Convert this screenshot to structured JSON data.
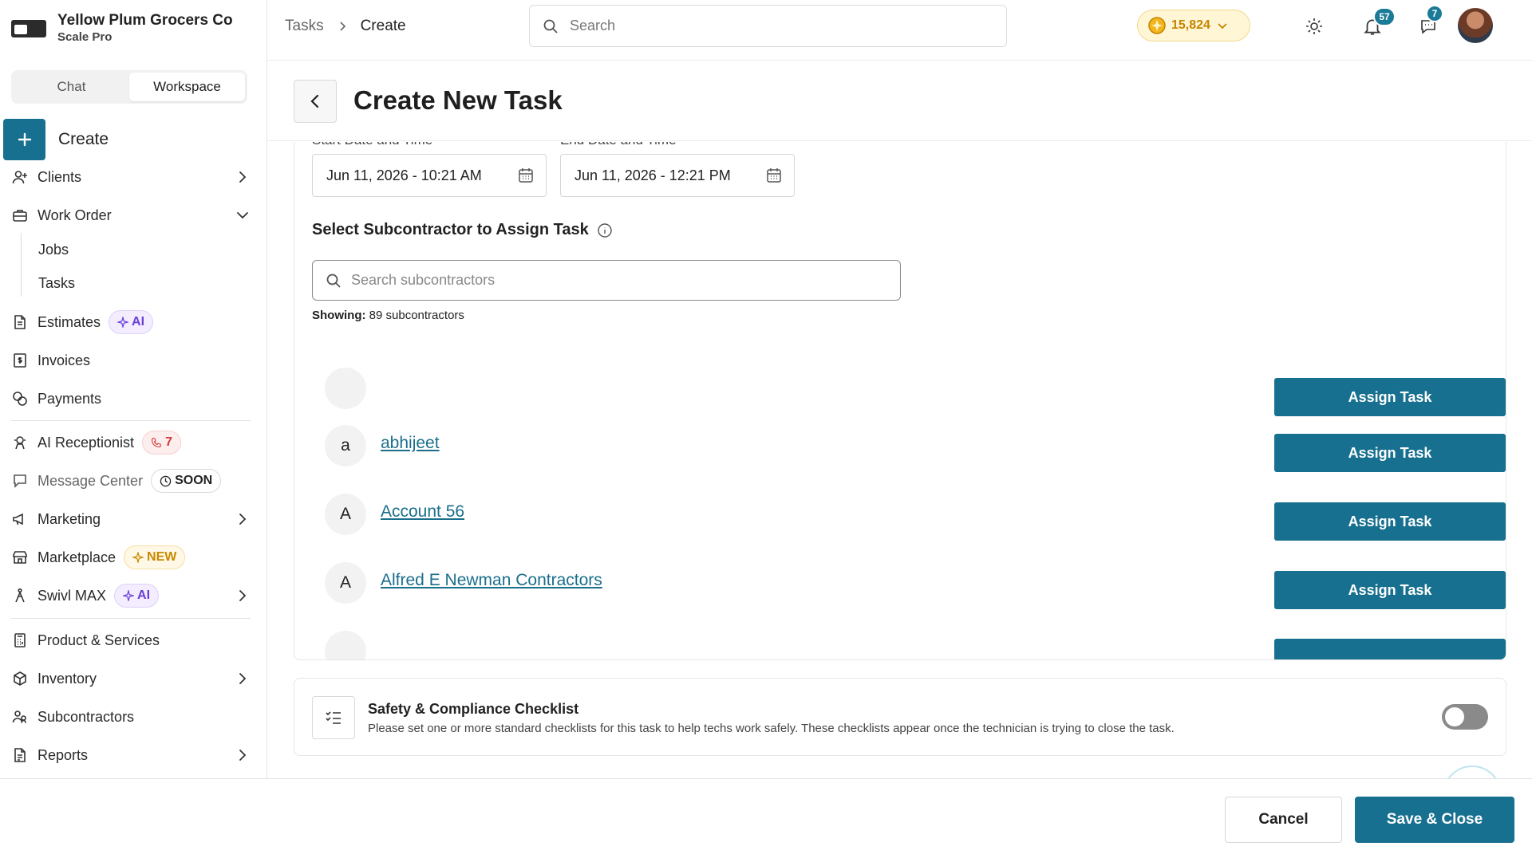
{
  "brand": {
    "name": "Yellow Plum Grocers Co",
    "plan": "Scale Pro"
  },
  "mode_toggle": {
    "options": [
      "Chat",
      "Workspace"
    ],
    "active": "Workspace"
  },
  "sidebar": {
    "create_label": "Create",
    "items": [
      {
        "label": "Clients",
        "icon": "user-plus-icon"
      },
      {
        "label": "Work Order",
        "icon": "briefcase-icon",
        "sub": [
          "Jobs",
          "Tasks"
        ]
      },
      {
        "label": "Estimates",
        "icon": "document-icon",
        "badge": "AI"
      },
      {
        "label": "Invoices",
        "icon": "invoice-icon"
      },
      {
        "label": "Payments",
        "icon": "coins-icon"
      },
      {
        "label": "AI Receptionist",
        "icon": "receptionist-icon",
        "badge": "7"
      },
      {
        "label": "Message Center",
        "icon": "chat-bubble-icon",
        "badge": "SOON"
      },
      {
        "label": "Marketing",
        "icon": "megaphone-icon"
      },
      {
        "label": "Marketplace",
        "icon": "store-icon",
        "badge": "NEW"
      },
      {
        "label": "Swivl MAX",
        "icon": "runner-icon",
        "badge": "AI"
      },
      {
        "label": "Product & Services",
        "icon": "calculator-icon"
      },
      {
        "label": "Inventory",
        "icon": "box-icon"
      },
      {
        "label": "Subcontractors",
        "icon": "users-icon"
      },
      {
        "label": "Reports",
        "icon": "report-icon"
      }
    ]
  },
  "topbar": {
    "breadcrumb": [
      "Tasks",
      "Create"
    ],
    "search_placeholder": "Search",
    "coins": "15,824",
    "notifications_count": "57",
    "messages_count": "7"
  },
  "page": {
    "title": "Create New Task"
  },
  "dates": {
    "start_label": "Start Date and Time",
    "start_value": "Jun 11, 2026 - 10:21 AM",
    "end_label": "End Date and Time",
    "end_value": "Jun 11, 2026 - 12:21 PM"
  },
  "subcontractors": {
    "section_title": "Select Subcontractor to Assign Task",
    "search_placeholder": "Search subcontractors",
    "showing_label": "Showing:",
    "showing_value": "89 subcontractors",
    "assign_label": "Assign Task",
    "rows": [
      {
        "initial": "",
        "name": ""
      },
      {
        "initial": "a",
        "name": "abhijeet"
      },
      {
        "initial": "A",
        "name": "Account 56"
      },
      {
        "initial": "A",
        "name": "Alfred E Newman Contractors"
      }
    ]
  },
  "checklist": {
    "title": "Safety & Compliance Checklist",
    "description": "Please set one or more standard checklists for this task to help techs work safely. These checklists appear once the technician is trying to close the task.",
    "enabled": false
  },
  "footer": {
    "cancel_label": "Cancel",
    "save_label": "Save & Close"
  },
  "colors": {
    "primary": "#17708f",
    "link": "#1a6f8c",
    "coin": "#c58400"
  }
}
